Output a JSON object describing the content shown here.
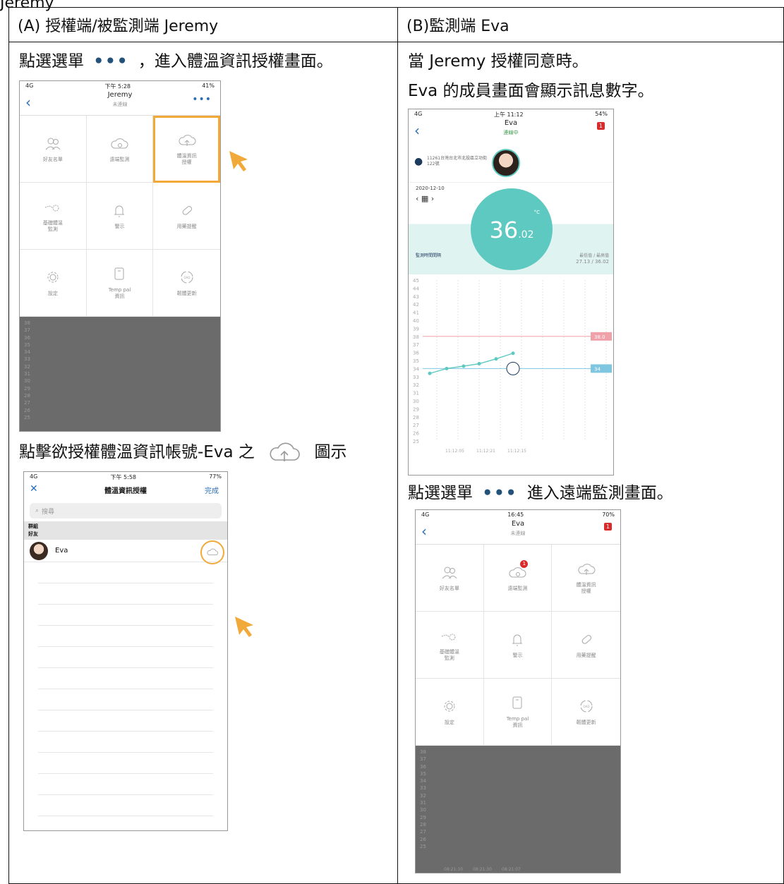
{
  "top_partial_text": "Jeremy",
  "headers": {
    "a": "(A)  授權端/被監測端 Jeremy",
    "b": "(B)監測端 Eva"
  },
  "col_a": {
    "step1_prefix": "點選選單",
    "step1_suffix": "，進入體溫資訊授權畫面。",
    "dots": "•••",
    "step2_prefix": "點擊欲授權體溫資訊帳號-Eva 之",
    "step2_suffix": "圖示",
    "phone1": {
      "status_left": "4G",
      "status_time": "下午 5:28",
      "status_right": "41%",
      "back": "‹",
      "title": "Jeremy",
      "subtitle": "未連線",
      "more": "•••",
      "grid": [
        {
          "label": "好友名單",
          "icon": "friends-icon"
        },
        {
          "label": "遠端監測",
          "icon": "cloud-eye-icon"
        },
        {
          "label": "體溫資訊\n授權",
          "icon": "cloud-upload-icon"
        },
        {
          "label": "基礎體溫\n監測",
          "icon": "chart-sparkle-icon"
        },
        {
          "label": "警示",
          "icon": "bell-icon"
        },
        {
          "label": "用藥提醒",
          "icon": "pill-icon"
        },
        {
          "label": "設定",
          "icon": "gear-icon"
        },
        {
          "label": "Temp pal\n資訊",
          "icon": "device-icon"
        },
        {
          "label": "韌體更新",
          "icon": "refresh-icon"
        }
      ],
      "ticks": [
        "38",
        "37",
        "36",
        "35",
        "34",
        "33",
        "32",
        "31",
        "30",
        "29",
        "28",
        "27",
        "26",
        "25"
      ]
    },
    "phone2": {
      "status_left": "4G",
      "status_time": "下午 5:58",
      "status_right": "77%",
      "close": "✕",
      "title": "體溫資訊授權",
      "done": "完成",
      "search_placeholder": "搜尋",
      "section_group": "群組",
      "section_friends": "好友",
      "friend_name": "Eva"
    }
  },
  "col_b": {
    "line1": "當 Jeremy 授權同意時。",
    "line2": "Eva 的成員畫面會顯示訊息數字。",
    "step3_prefix": "點選選單",
    "dots": "•••",
    "step3_suffix": "進入遠端監測畫面。",
    "phone3": {
      "status_left": "4G",
      "status_time": "上午 11:12",
      "status_right": "54%",
      "title": "Eva",
      "subtitle": "連線中",
      "badge": "1",
      "address": "11261台灣台北市北投區立功街122號",
      "date": "2020-12-10",
      "temp_main": "36",
      "temp_dec": ".02",
      "unit": "°C",
      "mode_left": "監測時間間隔",
      "mode_right": "最低值 / 最高值",
      "minmax": "27.13 / 36.02",
      "high_mark": "38.0",
      "low_mark": "34",
      "x_labels": [
        "11:12:05",
        "11:12:21",
        "11:12:15"
      ]
    },
    "phone4": {
      "status_left": "4G",
      "status_time": "16:45",
      "status_right": "70%",
      "title": "Eva",
      "subtitle": "未連線",
      "badge": "1",
      "grid": [
        {
          "label": "好友名單",
          "icon": "friends-icon"
        },
        {
          "label": "遠端監測",
          "icon": "cloud-eye-icon",
          "badge": "1"
        },
        {
          "label": "體溫資訊\n授權",
          "icon": "cloud-upload-icon"
        },
        {
          "label": "基礎體溫\n監測",
          "icon": "chart-sparkle-icon"
        },
        {
          "label": "警示",
          "icon": "bell-icon"
        },
        {
          "label": "用藥提醒",
          "icon": "pill-icon"
        },
        {
          "label": "設定",
          "icon": "gear-icon"
        },
        {
          "label": "Temp pal\n資訊",
          "icon": "device-icon"
        },
        {
          "label": "韌體更新",
          "icon": "refresh-icon"
        }
      ],
      "x_labels": [
        "08:21:10",
        "08:21:30",
        "08:21:07"
      ]
    }
  },
  "colors": {
    "accent": "#f1a93a",
    "teal": "#5ec9c0",
    "link": "#2a6fb5"
  }
}
